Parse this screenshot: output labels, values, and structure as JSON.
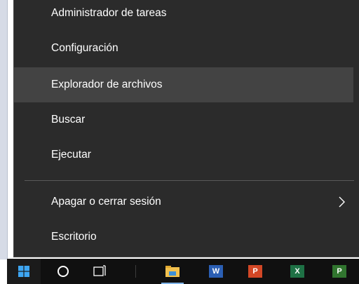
{
  "menu": {
    "items": [
      {
        "label": "Administrador de tareas"
      },
      {
        "label": "Configuración"
      },
      {
        "label": "Explorador de archivos"
      },
      {
        "label": "Buscar"
      },
      {
        "label": "Ejecutar"
      },
      {
        "label": "Apagar o cerrar sesión"
      },
      {
        "label": "Escritorio"
      }
    ],
    "hovered_item": "Explorador de archivos"
  },
  "taskbar": {
    "icons": [
      "windows-start-icon",
      "cortana-circle-icon",
      "task-view-icon",
      "file-explorer-icon",
      "word-icon",
      "powerpoint-icon",
      "excel-icon",
      "project-icon"
    ],
    "letters": {
      "word": "W",
      "powerpoint": "P",
      "excel": "X",
      "project": "P"
    }
  },
  "colors": {
    "menu_bg": "#2b2b2b",
    "hover_bg": "#434343",
    "text": "#ffffff",
    "start_blue": "#3ea6f2",
    "word_blue": "#2b5fb4",
    "ppt_red": "#d24726",
    "excel_green": "#1e7145",
    "project_green": "#31752f",
    "explorer_yellow": "#f2c14e"
  }
}
